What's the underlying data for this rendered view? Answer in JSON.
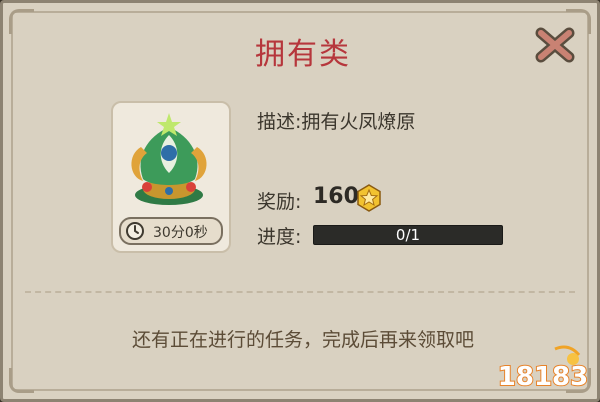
{
  "dialog": {
    "title": "拥有类",
    "close_icon": "close-x-icon"
  },
  "item": {
    "icon": "phoenix-trophy-icon",
    "timer_icon": "clock-icon",
    "timer_text": "30分0秒"
  },
  "details": {
    "description_label": "描述:",
    "description_value": "拥有火凤燎原",
    "reward_label": "奖励:",
    "reward_value": "160",
    "reward_icon": "gold-star-coin-icon",
    "progress_label": "进度:",
    "progress_text": "0/1",
    "progress_fraction": 0
  },
  "hint": "还有正在进行的任务，完成后再来领取吧",
  "watermark": {
    "text": "18183"
  },
  "colors": {
    "title": "#b6363c",
    "panel_bg": "#d9d1c1",
    "progress_bg": "#2b2b28",
    "coin": "#f2c230"
  }
}
